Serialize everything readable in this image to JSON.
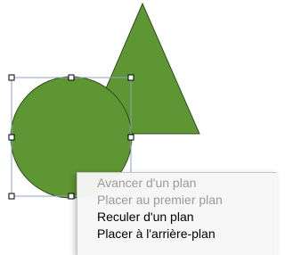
{
  "colors": {
    "shape_fill": "#5d9632",
    "shape_stroke": "#2f4f1c",
    "selection_stroke": "#8fa0c8",
    "menu_disabled_text": "#9a9a9a"
  },
  "canvas": {
    "shapes": [
      "triangle",
      "circle"
    ],
    "selected_shape": "circle"
  },
  "context_menu": {
    "items": [
      {
        "label": "Avancer d'un plan",
        "enabled": false
      },
      {
        "label": "Placer au premier plan",
        "enabled": false
      },
      {
        "label": "Reculer d'un plan",
        "enabled": true
      },
      {
        "label": "Placer à l'arrière-plan",
        "enabled": true
      }
    ]
  }
}
